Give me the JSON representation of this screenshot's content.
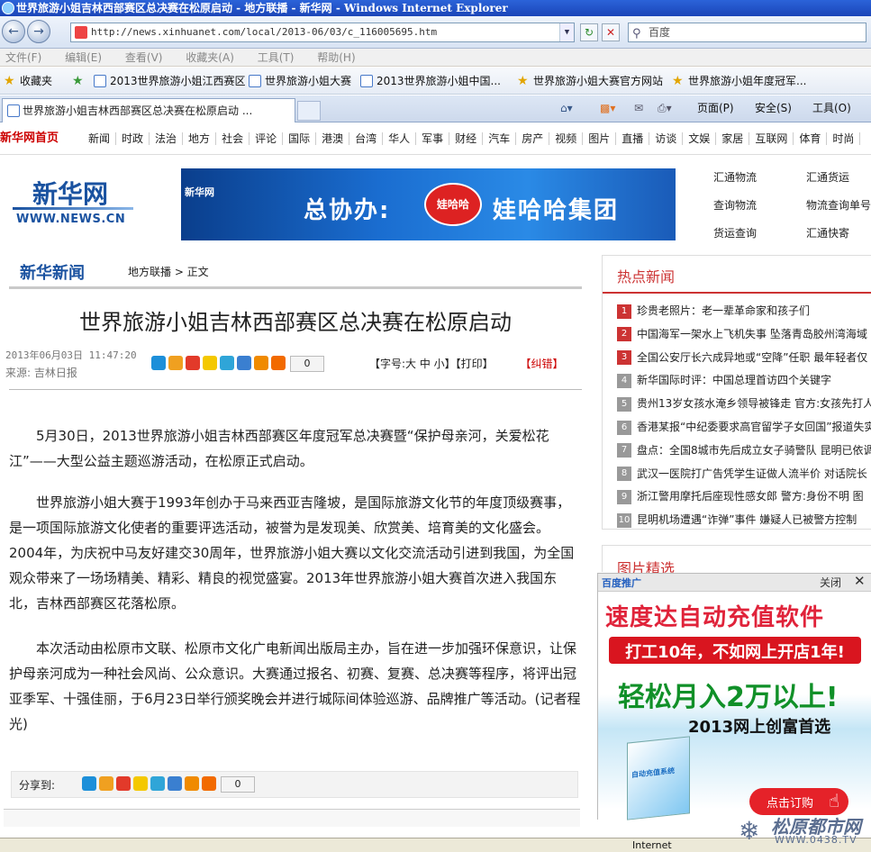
{
  "window": {
    "title": "世界旅游小姐吉林西部赛区总决赛在松原启动 - 地方联播 - 新华网 - Windows Internet Explorer"
  },
  "addressbar": {
    "url": "http://news.xinhuanet.com/local/2013-06/03/c_116005695.htm",
    "search_placeholder": "百度"
  },
  "menubar": {
    "items": [
      "文件(F)",
      "编辑(E)",
      "查看(V)",
      "收藏夹(A)",
      "工具(T)",
      "帮助(H)"
    ]
  },
  "favorites": {
    "label": "收藏夹",
    "items": [
      "2013世界旅游小姐江西赛区",
      "世界旅游小姐大赛",
      "2013世界旅游小姐中国...",
      "世界旅游小姐大赛官方网站",
      "世界旅游小姐年度冠军..."
    ]
  },
  "tabs": {
    "active_label": "世界旅游小姐吉林西部赛区总决赛在松原启动 ...",
    "tools": {
      "page": "页面(P)",
      "safety": "安全(S)",
      "tools": "工具(O)"
    }
  },
  "sitenav": {
    "home": "新华网首页",
    "items": [
      "新闻",
      "时政",
      "法治",
      "地方",
      "社会",
      "评论",
      "国际",
      "港澳",
      "台湾",
      "华人",
      "军事",
      "财经",
      "汽车",
      "房产",
      "视频",
      "图片",
      "直播",
      "访谈",
      "文娱",
      "家居",
      "互联网",
      "体育",
      "时尚"
    ]
  },
  "header": {
    "logo_text": "新华网",
    "logo_url": "WWW.NEWS.CN",
    "banner": {
      "brand": "新华网",
      "text1": "总协办:",
      "logo_word": "娃哈哈",
      "text2": "娃哈哈集团"
    },
    "links": [
      "汇通物流",
      "汇通货运",
      "查询物流",
      "物流查询单号",
      "货运查询",
      "汇通快寄"
    ]
  },
  "article": {
    "column": "新华新闻",
    "breadcrumb": "地方联播 > 正文",
    "title": "世界旅游小姐吉林西部赛区总决赛在松原启动",
    "datetime": "2013年06月03日 11:47:20",
    "source": "来源: 吉林日报",
    "share_count": "0",
    "fontsize_label": "【字号:大 中 小】【打印】",
    "report_label": "【纠错】",
    "paragraphs": [
      "5月30日，2013世界旅游小姐吉林西部赛区年度冠军总决赛暨“保护母亲河，关爱松花江”——大型公益主题巡游活动，在松原正式启动。",
      "世界旅游小姐大赛于1993年创办于马来西亚吉隆坡，是国际旅游文化节的年度顶级赛事，是一项国际旅游文化使者的重要评选活动，被誉为是发现美、欣赏美、培育美的文化盛会。2004年，为庆祝中马友好建交30周年，世界旅游小姐大赛以文化交流活动引进到我国，为全国观众带来了一场场精美、精彩、精良的视觉盛宴。2013年世界旅游小姐大赛首次进入我国东北，吉林西部赛区花落松原。",
      "本次活动由松原市文联、松原市文化广电新闻出版局主办，旨在进一步加强环保意识，让保护母亲河成为一种社会风尚、公众意识。大赛通过报名、初赛、复赛、总决赛等程序，将评出冠亚季军、十强佳丽，于6月23日举行颁奖晚会并进行城际间体验巡游、品牌推广等活动。(记者程光)"
    ],
    "share_label": "分享到:"
  },
  "hotnews": {
    "title": "热点新闻",
    "items": [
      {
        "n": "1",
        "text": "珍贵老照片：老一辈革命家和孩子们"
      },
      {
        "n": "2",
        "text": "中国海军一架水上飞机失事 坠落青岛胶州湾海域"
      },
      {
        "n": "3",
        "text": "全国公安厅长六成异地或“空降”任职 最年轻者仅"
      },
      {
        "n": "4",
        "text": "新华国际时评：中国总理首访四个关键字"
      },
      {
        "n": "5",
        "text": "贵州13岁女孩水淹乡领导被锋走 官方:女孩先打人"
      },
      {
        "n": "6",
        "text": "香港某报“中纪委要求高官留学子女回国”报道失实"
      },
      {
        "n": "7",
        "text": "盘点：全国8城市先后成立女子骑警队 昆明已依调"
      },
      {
        "n": "8",
        "text": "武汉一医院打广告凭学生证做人流半价 对话院长"
      },
      {
        "n": "9",
        "text": "浙江警用摩托后座现性感女郎 警方:身份不明 图"
      },
      {
        "n": "10",
        "text": "昆明机场遭遇“诈弹”事件 嫌疑人已被警方控制"
      }
    ],
    "pics_title": "图片精选"
  },
  "popup": {
    "brand": "百度推广",
    "close_label": "关闭",
    "line1": "速度达自动充值软件",
    "line2": "打工10年，不如网上开店1年!",
    "line3": "轻松月入2万以上!",
    "line4": "2013网上创富首选",
    "box_title": "自动充值系统",
    "button": "点击订购"
  },
  "statusbar": {
    "zone": "Internet"
  },
  "watermark": {
    "text": "松原都市网",
    "url": "WWW.0438.TV"
  },
  "colors": {
    "accent_blue": "#1a52a0",
    "hot_red": "#c33"
  }
}
